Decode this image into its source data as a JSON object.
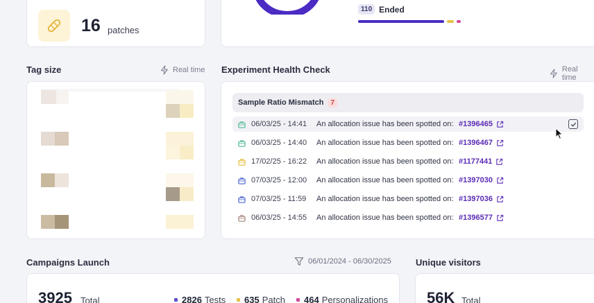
{
  "patch_card": {
    "count": "16",
    "label": "patches"
  },
  "status_card": {
    "ended_count": "110",
    "ended_label": "Ended"
  },
  "tag_size": {
    "title": "Tag size",
    "realtime": "Real time"
  },
  "health_check": {
    "title": "Experiment Health Check",
    "realtime": "Real time",
    "group_title": "Sample Ratio Mismatch",
    "group_count": "7",
    "rows": [
      {
        "date": "06/03/25 - 14:41",
        "message": "An allocation issue has been spotted on:",
        "link": "#1396465",
        "bag_color": "#5dbf99"
      },
      {
        "date": "06/03/25 - 14:40",
        "message": "An allocation issue has been spotted on:",
        "link": "#1396467",
        "bag_color": "#5dbf99"
      },
      {
        "date": "17/02/25 - 16:22",
        "message": "An allocation issue has been spotted on:",
        "link": "#1177441",
        "bag_color": "#e6c24a"
      },
      {
        "date": "07/03/25 - 12:00",
        "message": "An allocation issue has been spotted on:",
        "link": "#1397030",
        "bag_color": "#5a6fd6"
      },
      {
        "date": "07/03/25 - 11:59",
        "message": "An allocation issue has been spotted on:",
        "link": "#1397036",
        "bag_color": "#5a6fd6"
      },
      {
        "date": "06/03/25 - 14:55",
        "message": "An allocation issue has been spotted on:",
        "link": "#1396577",
        "bag_color": "#a98d84"
      }
    ]
  },
  "campaigns": {
    "title": "Campaigns Launch",
    "date_range": "06/01/2024 - 06/30/2025",
    "total": "3925",
    "total_label": "Total",
    "legend": [
      {
        "value": "2826",
        "label": "Tests",
        "color": "#5b4fc7"
      },
      {
        "value": "635",
        "label": "Patch",
        "color": "#e6c24a"
      },
      {
        "value": "464",
        "label": "Personalizations",
        "color": "#d0499a"
      }
    ]
  },
  "visitors": {
    "title": "Unique visitors",
    "total": "56K",
    "total_label": "Total"
  },
  "colors": {
    "accent": "#5b2bb5",
    "donut": "#4b2bc4"
  }
}
